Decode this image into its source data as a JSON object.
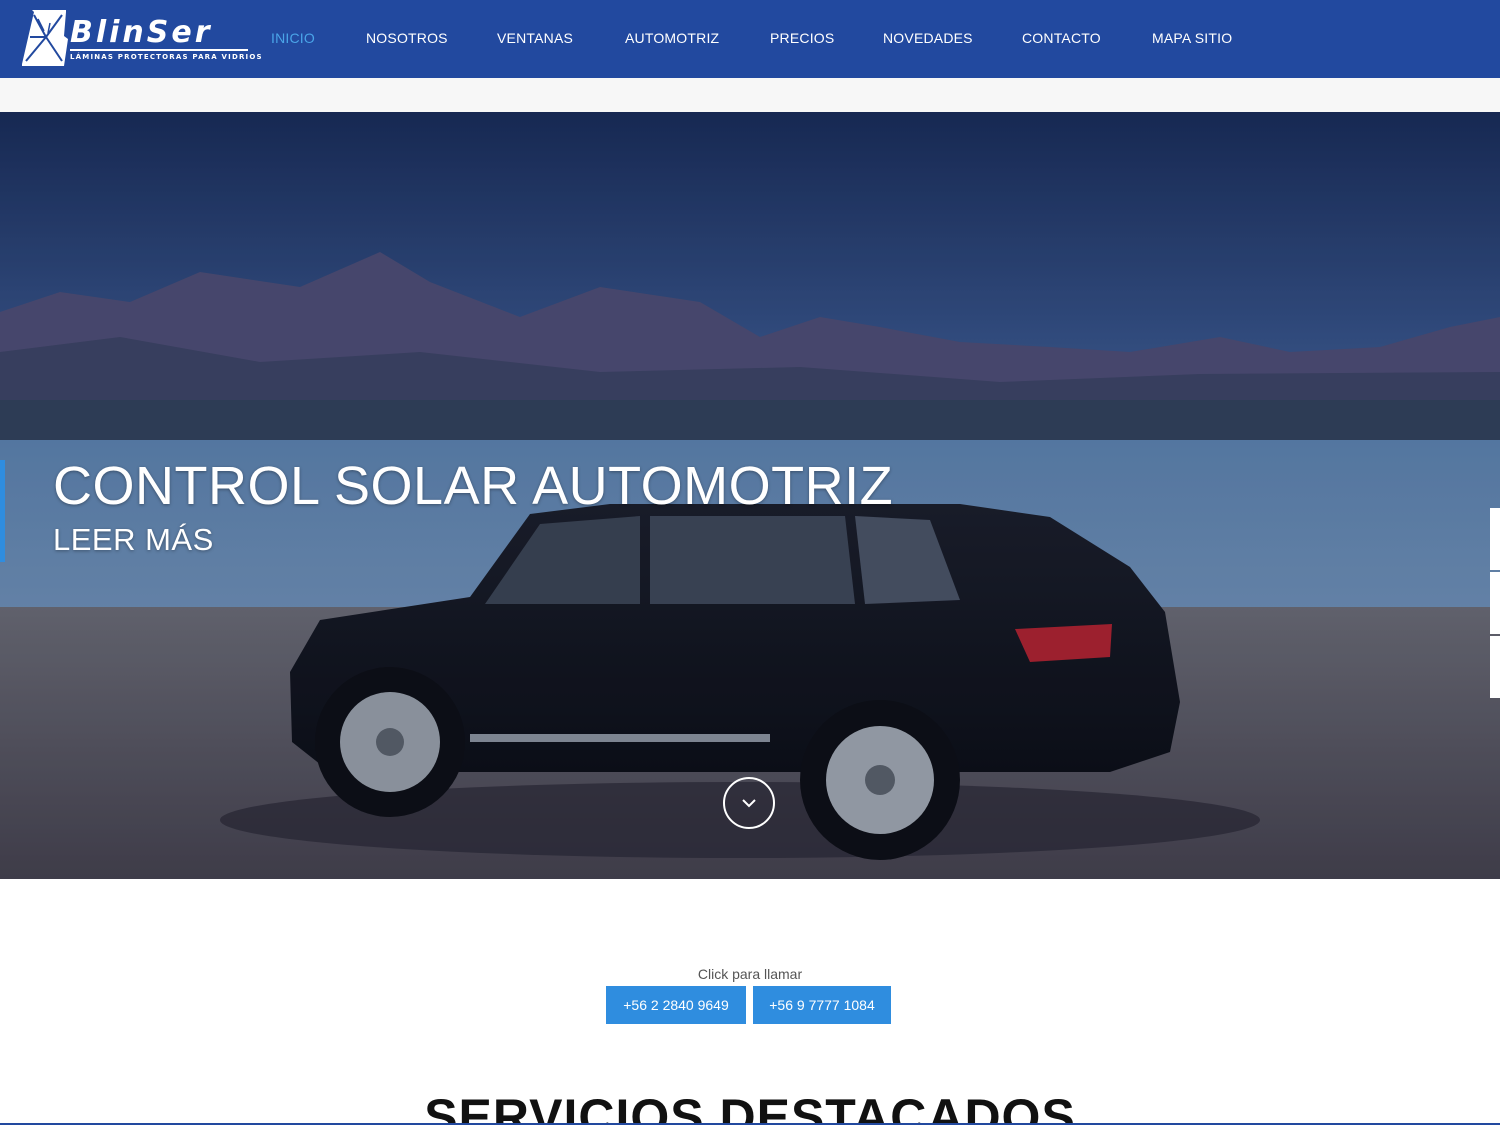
{
  "brand": {
    "name": "BlinSer",
    "tagline": "Láminas protectoras para vidrios",
    "color": "#22499f"
  },
  "nav": {
    "items": [
      {
        "label": "INICIO",
        "active": true
      },
      {
        "label": "NOSOTROS",
        "active": false
      },
      {
        "label": "VENTANAS",
        "active": false
      },
      {
        "label": "AUTOMOTRIZ",
        "active": false
      },
      {
        "label": "PRECIOS",
        "active": false
      },
      {
        "label": "NOVEDADES",
        "active": false
      },
      {
        "label": "CONTACTO",
        "active": false
      },
      {
        "label": "MAPA SITIO",
        "active": false
      }
    ],
    "active_color": "#4aa4e8"
  },
  "hero": {
    "title": "CONTROL SOLAR AUTOMOTRIZ",
    "link_label": "LEER MÁS",
    "scroll_icon": "chevron-down-icon",
    "accent_color": "#2f8ddf"
  },
  "call": {
    "label": "Click para llamar",
    "phones": [
      "+56 2 2840 9649",
      "+56 9 7777 1084"
    ],
    "button_color": "#2f8ddf"
  },
  "featured": {
    "heading": "SERVICIOS DESTACADOS"
  }
}
